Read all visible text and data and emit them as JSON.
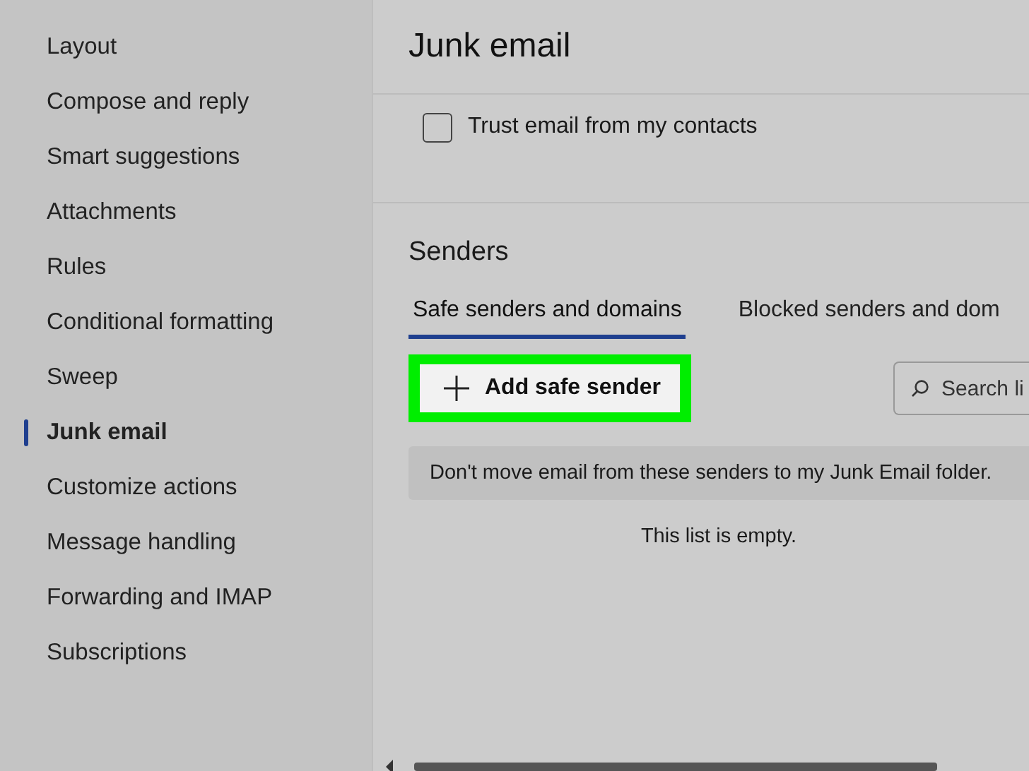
{
  "sidebar": {
    "items": [
      {
        "label": "Layout",
        "selected": false
      },
      {
        "label": "Compose and reply",
        "selected": false
      },
      {
        "label": "Smart suggestions",
        "selected": false
      },
      {
        "label": "Attachments",
        "selected": false
      },
      {
        "label": "Rules",
        "selected": false
      },
      {
        "label": "Conditional formatting",
        "selected": false
      },
      {
        "label": "Sweep",
        "selected": false
      },
      {
        "label": "Junk email",
        "selected": true
      },
      {
        "label": "Customize actions",
        "selected": false
      },
      {
        "label": "Message handling",
        "selected": false
      },
      {
        "label": "Forwarding and IMAP",
        "selected": false
      },
      {
        "label": "Subscriptions",
        "selected": false
      }
    ]
  },
  "panel": {
    "title": "Junk email",
    "trust_contacts": {
      "label": "Trust email from my contacts",
      "checked": false
    },
    "section_title": "Senders",
    "tabs": [
      {
        "label": "Safe senders and domains",
        "selected": true
      },
      {
        "label": "Blocked senders and dom",
        "selected": false
      }
    ],
    "add_button": {
      "label": "Add safe sender",
      "highlighted": true
    },
    "search": {
      "placeholder": "Search li"
    },
    "info": "Don't move email from these senders to my Junk Email folder.",
    "empty_message": "This list is empty."
  }
}
